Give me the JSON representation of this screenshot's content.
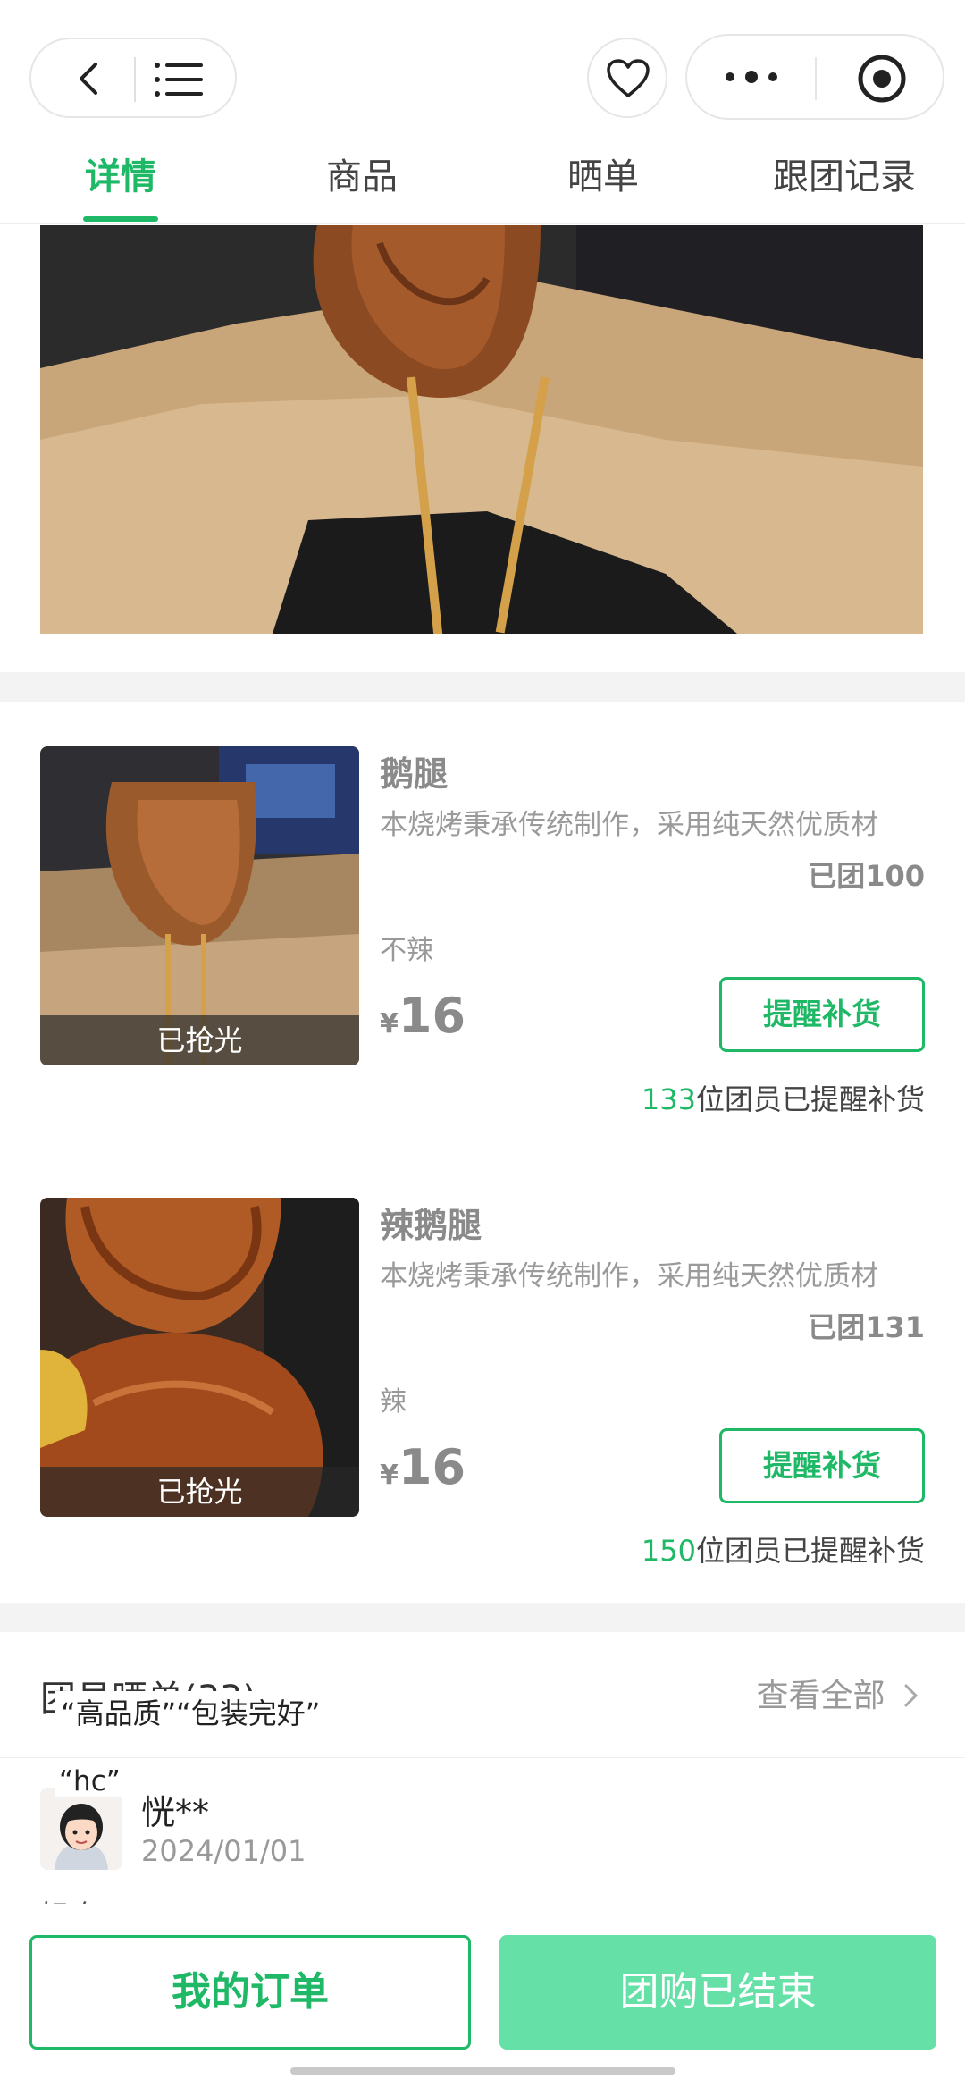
{
  "header": {
    "icons": [
      "back-arrow-icon",
      "list-menu-icon",
      "heart-icon",
      "more-dots-icon",
      "record-target-icon"
    ]
  },
  "tabs": [
    {
      "label": "详情",
      "active": true
    },
    {
      "label": "商品",
      "active": false
    },
    {
      "label": "晒单",
      "active": false
    },
    {
      "label": "跟团记录",
      "active": false
    }
  ],
  "colors": {
    "accent": "#1fb866",
    "button_disabled": "#65e0a7",
    "gap": "#f3f3f3"
  },
  "products": [
    {
      "name": "鹅腿",
      "desc": "本烧烤秉承传统制作，采用纯天然优质材",
      "sold": "已团100",
      "spec": "不辣",
      "currency": "¥",
      "price": "16",
      "status_label": "已抢光",
      "remind_button": "提醒补货",
      "remind_count": "133",
      "remind_suffix": "位团员已提醒补货"
    },
    {
      "name": "辣鹅腿",
      "desc": "本烧烤秉承传统制作，采用纯天然优质材",
      "sold": "已团131",
      "spec": "辣",
      "currency": "¥",
      "price": "16",
      "status_label": "已抢光",
      "remind_button": "提醒补货",
      "remind_count": "150",
      "remind_suffix": "位团员已提醒补货"
    }
  ],
  "reviews": {
    "title": "团员晒单(33)",
    "view_all": "查看全部",
    "tags": "“高品质”“包装完好”",
    "hc_tag": "“hc”",
    "item": {
      "user": "恍**",
      "date": "2024/01/01",
      "text_cut": "好吃"
    }
  },
  "bottom": {
    "orders": "我的订单",
    "ended": "团购已结束"
  }
}
